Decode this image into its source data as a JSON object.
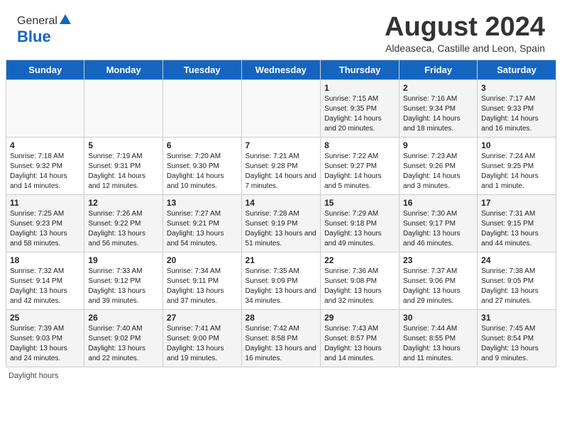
{
  "header": {
    "logo_general": "General",
    "logo_blue": "Blue",
    "month_title": "August 2024",
    "subtitle": "Aldeaseca, Castille and Leon, Spain"
  },
  "days_of_week": [
    "Sunday",
    "Monday",
    "Tuesday",
    "Wednesday",
    "Thursday",
    "Friday",
    "Saturday"
  ],
  "weeks": [
    [
      {
        "num": "",
        "info": ""
      },
      {
        "num": "",
        "info": ""
      },
      {
        "num": "",
        "info": ""
      },
      {
        "num": "",
        "info": ""
      },
      {
        "num": "1",
        "info": "Sunrise: 7:15 AM\nSunset: 9:35 PM\nDaylight: 14 hours and 20 minutes."
      },
      {
        "num": "2",
        "info": "Sunrise: 7:16 AM\nSunset: 9:34 PM\nDaylight: 14 hours and 18 minutes."
      },
      {
        "num": "3",
        "info": "Sunrise: 7:17 AM\nSunset: 9:33 PM\nDaylight: 14 hours and 16 minutes."
      }
    ],
    [
      {
        "num": "4",
        "info": "Sunrise: 7:18 AM\nSunset: 9:32 PM\nDaylight: 14 hours and 14 minutes."
      },
      {
        "num": "5",
        "info": "Sunrise: 7:19 AM\nSunset: 9:31 PM\nDaylight: 14 hours and 12 minutes."
      },
      {
        "num": "6",
        "info": "Sunrise: 7:20 AM\nSunset: 9:30 PM\nDaylight: 14 hours and 10 minutes."
      },
      {
        "num": "7",
        "info": "Sunrise: 7:21 AM\nSunset: 9:28 PM\nDaylight: 14 hours and 7 minutes."
      },
      {
        "num": "8",
        "info": "Sunrise: 7:22 AM\nSunset: 9:27 PM\nDaylight: 14 hours and 5 minutes."
      },
      {
        "num": "9",
        "info": "Sunrise: 7:23 AM\nSunset: 9:26 PM\nDaylight: 14 hours and 3 minutes."
      },
      {
        "num": "10",
        "info": "Sunrise: 7:24 AM\nSunset: 9:25 PM\nDaylight: 14 hours and 1 minute."
      }
    ],
    [
      {
        "num": "11",
        "info": "Sunrise: 7:25 AM\nSunset: 9:23 PM\nDaylight: 13 hours and 58 minutes."
      },
      {
        "num": "12",
        "info": "Sunrise: 7:26 AM\nSunset: 9:22 PM\nDaylight: 13 hours and 56 minutes."
      },
      {
        "num": "13",
        "info": "Sunrise: 7:27 AM\nSunset: 9:21 PM\nDaylight: 13 hours and 54 minutes."
      },
      {
        "num": "14",
        "info": "Sunrise: 7:28 AM\nSunset: 9:19 PM\nDaylight: 13 hours and 51 minutes."
      },
      {
        "num": "15",
        "info": "Sunrise: 7:29 AM\nSunset: 9:18 PM\nDaylight: 13 hours and 49 minutes."
      },
      {
        "num": "16",
        "info": "Sunrise: 7:30 AM\nSunset: 9:17 PM\nDaylight: 13 hours and 46 minutes."
      },
      {
        "num": "17",
        "info": "Sunrise: 7:31 AM\nSunset: 9:15 PM\nDaylight: 13 hours and 44 minutes."
      }
    ],
    [
      {
        "num": "18",
        "info": "Sunrise: 7:32 AM\nSunset: 9:14 PM\nDaylight: 13 hours and 42 minutes."
      },
      {
        "num": "19",
        "info": "Sunrise: 7:33 AM\nSunset: 9:12 PM\nDaylight: 13 hours and 39 minutes."
      },
      {
        "num": "20",
        "info": "Sunrise: 7:34 AM\nSunset: 9:11 PM\nDaylight: 13 hours and 37 minutes."
      },
      {
        "num": "21",
        "info": "Sunrise: 7:35 AM\nSunset: 9:09 PM\nDaylight: 13 hours and 34 minutes."
      },
      {
        "num": "22",
        "info": "Sunrise: 7:36 AM\nSunset: 9:08 PM\nDaylight: 13 hours and 32 minutes."
      },
      {
        "num": "23",
        "info": "Sunrise: 7:37 AM\nSunset: 9:06 PM\nDaylight: 13 hours and 29 minutes."
      },
      {
        "num": "24",
        "info": "Sunrise: 7:38 AM\nSunset: 9:05 PM\nDaylight: 13 hours and 27 minutes."
      }
    ],
    [
      {
        "num": "25",
        "info": "Sunrise: 7:39 AM\nSunset: 9:03 PM\nDaylight: 13 hours and 24 minutes."
      },
      {
        "num": "26",
        "info": "Sunrise: 7:40 AM\nSunset: 9:02 PM\nDaylight: 13 hours and 22 minutes."
      },
      {
        "num": "27",
        "info": "Sunrise: 7:41 AM\nSunset: 9:00 PM\nDaylight: 13 hours and 19 minutes."
      },
      {
        "num": "28",
        "info": "Sunrise: 7:42 AM\nSunset: 8:58 PM\nDaylight: 13 hours and 16 minutes."
      },
      {
        "num": "29",
        "info": "Sunrise: 7:43 AM\nSunset: 8:57 PM\nDaylight: 13 hours and 14 minutes."
      },
      {
        "num": "30",
        "info": "Sunrise: 7:44 AM\nSunset: 8:55 PM\nDaylight: 13 hours and 11 minutes."
      },
      {
        "num": "31",
        "info": "Sunrise: 7:45 AM\nSunset: 8:54 PM\nDaylight: 13 hours and 9 minutes."
      }
    ]
  ],
  "footer": {
    "daylight_label": "Daylight hours"
  }
}
